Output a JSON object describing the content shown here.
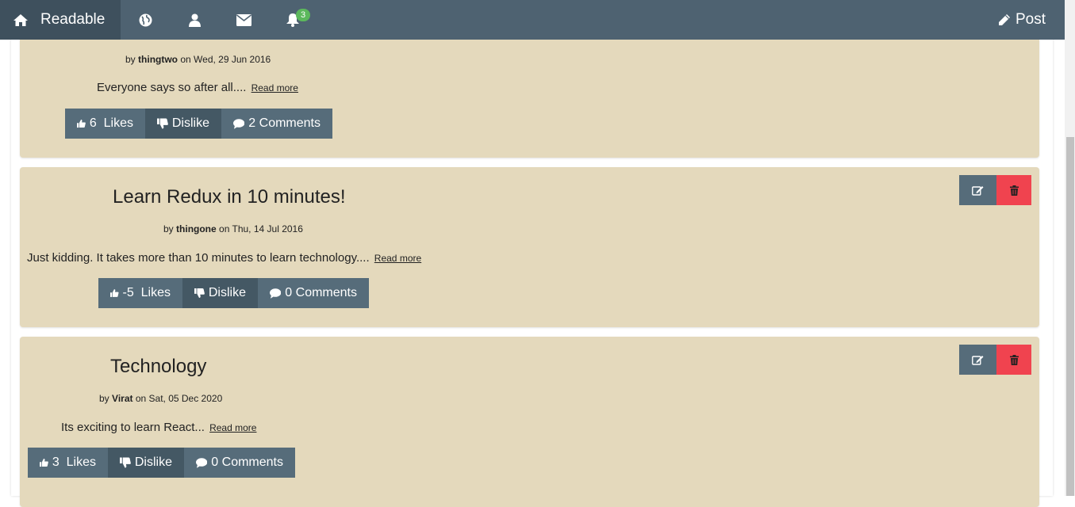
{
  "nav": {
    "brand": "Readable",
    "notification_count": "3",
    "post_label": "Post"
  },
  "posts": [
    {
      "author": "thingtwo",
      "date": "on Wed, 29 Jun 2016",
      "excerpt": "Everyone says so after all....",
      "read_more": "Read more",
      "likes": "6",
      "likes_label": "Likes",
      "dislike_label": "Dislike",
      "comments_label": "2 Comments"
    },
    {
      "title": "Learn Redux in 10 minutes!",
      "author": "thingone",
      "date": "on Thu, 14 Jul 2016",
      "excerpt": "Just kidding. It takes more than 10 minutes to learn technology....",
      "read_more": "Read more",
      "likes": "-5",
      "likes_label": "Likes",
      "dislike_label": "Dislike",
      "comments_label": "0 Comments"
    },
    {
      "title": "Technology",
      "author": "Virat",
      "date": "on Sat, 05 Dec 2020",
      "excerpt": "Its exciting to learn React...",
      "read_more": "Read more",
      "likes": "3",
      "likes_label": "Likes",
      "dislike_label": "Dislike",
      "comments_label": "0 Comments"
    }
  ],
  "byline_prefix": "by",
  "colors": {
    "navbar": "#4e6271",
    "brand_bg": "#3e505d",
    "card": "#e4d9bc",
    "button": "#566c7a",
    "delete": "#f0434f",
    "badge": "#5cb85c"
  }
}
